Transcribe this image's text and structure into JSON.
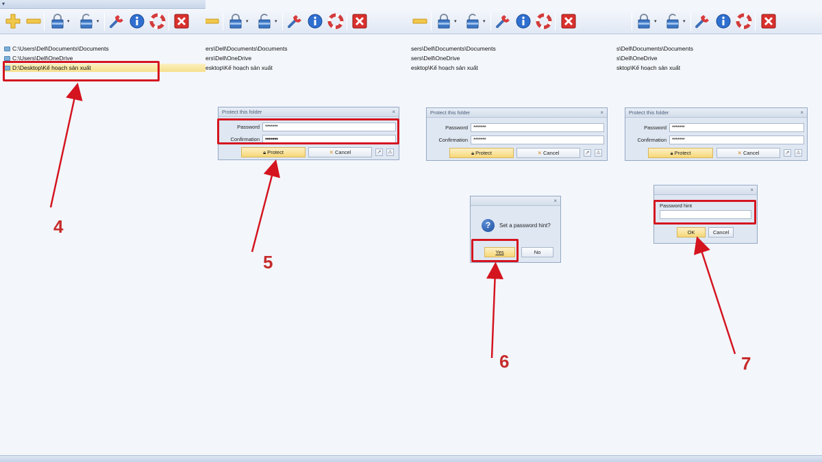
{
  "paths": {
    "p1": "C:\\Users\\Dell\\Documents\\Documents",
    "p2": "C:\\Users\\Dell\\OneDrive",
    "p3": "D:\\Desktop\\Kế hoạch sản xuất",
    "p1_cut_a": "ers\\Dell\\Documents\\Documents",
    "p2_cut_a": "",
    "p3_cut_a": "esktop\\Kế hoạch sản xuất",
    "p1_cut_b": "sers\\Dell\\Documents\\Documents",
    "p2_cut_b": "sers\\Dell\\OneDrive",
    "p3_cut_b": "esktop\\Kế hoạch sản xuất",
    "p1_cut_c": "s\\Dell\\Documents\\Documents",
    "p2_cut_c": "s\\Dell\\OneDrive",
    "p3_cut_c": "sktop\\Kế hoạch sản xuất",
    "p2_cut_x": "ers\\Dell\\OneDrive"
  },
  "protect_dialog": {
    "title": "Protect this folder",
    "password_label": "Password",
    "confirmation_label": "Confirmation",
    "password_value": "*******",
    "confirmation_value": "*******",
    "confirmation_dots": "•••••••",
    "protect_label": "Protect",
    "cancel_label": "Cancel"
  },
  "hint_question_dialog": {
    "message": "Set a password hint?",
    "yes_label": "Yes",
    "no_label": "No"
  },
  "hint_dialog": {
    "label": "Password hint",
    "value": "",
    "ok_label": "OK",
    "cancel_label": "Cancel"
  },
  "steps": {
    "s4": "4",
    "s5": "5",
    "s6": "6",
    "s7": "7"
  },
  "colors": {
    "highlight": "#d4141f",
    "arrow": "#d4141f",
    "step_number": "#c62b2b"
  }
}
